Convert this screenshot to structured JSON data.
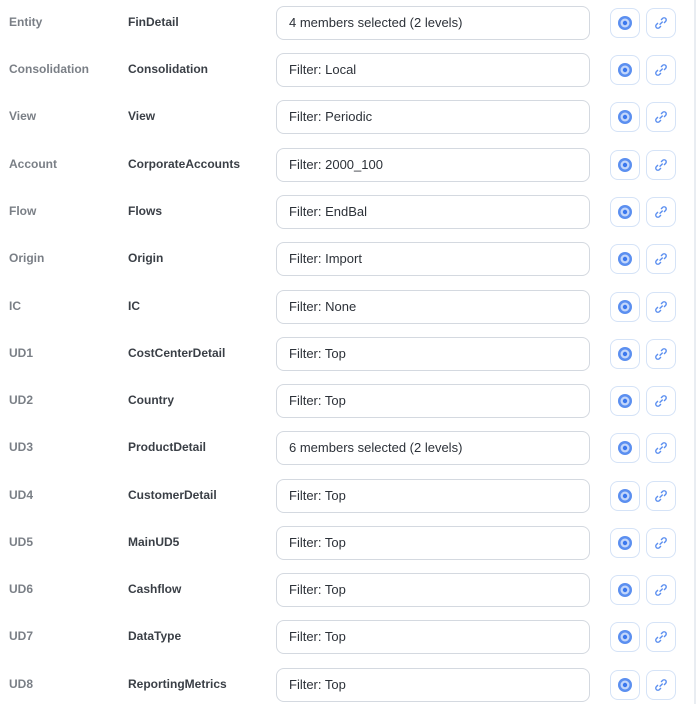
{
  "rows": [
    {
      "dimension": "Entity",
      "name": "FinDetail",
      "filter": "4 members selected (2 levels)"
    },
    {
      "dimension": "Consolidation",
      "name": "Consolidation",
      "filter": "Filter: Local"
    },
    {
      "dimension": "View",
      "name": "View",
      "filter": "Filter: Periodic"
    },
    {
      "dimension": "Account",
      "name": "CorporateAccounts",
      "filter": "Filter: 2000_100"
    },
    {
      "dimension": "Flow",
      "name": "Flows",
      "filter": "Filter: EndBal"
    },
    {
      "dimension": "Origin",
      "name": "Origin",
      "filter": "Filter: Import"
    },
    {
      "dimension": "IC",
      "name": "IC",
      "filter": "Filter: None"
    },
    {
      "dimension": "UD1",
      "name": "CostCenterDetail",
      "filter": "Filter: Top"
    },
    {
      "dimension": "UD2",
      "name": "Country",
      "filter": "Filter: Top"
    },
    {
      "dimension": "UD3",
      "name": "ProductDetail",
      "filter": "6 members selected (2 levels)"
    },
    {
      "dimension": "UD4",
      "name": "CustomerDetail",
      "filter": "Filter: Top"
    },
    {
      "dimension": "UD5",
      "name": "MainUD5",
      "filter": "Filter: Top"
    },
    {
      "dimension": "UD6",
      "name": "Cashflow",
      "filter": "Filter: Top"
    },
    {
      "dimension": "UD7",
      "name": "DataType",
      "filter": "Filter: Top"
    },
    {
      "dimension": "UD8",
      "name": "ReportingMetrics",
      "filter": "Filter: Top"
    }
  ],
  "icons": {
    "target": "target-icon",
    "link": "link-icon"
  },
  "colors": {
    "accent": "#3b82f6",
    "button_border": "#d5e3f7",
    "dimension_label": "#7a7f86",
    "dimension_name": "#3a3f46"
  }
}
